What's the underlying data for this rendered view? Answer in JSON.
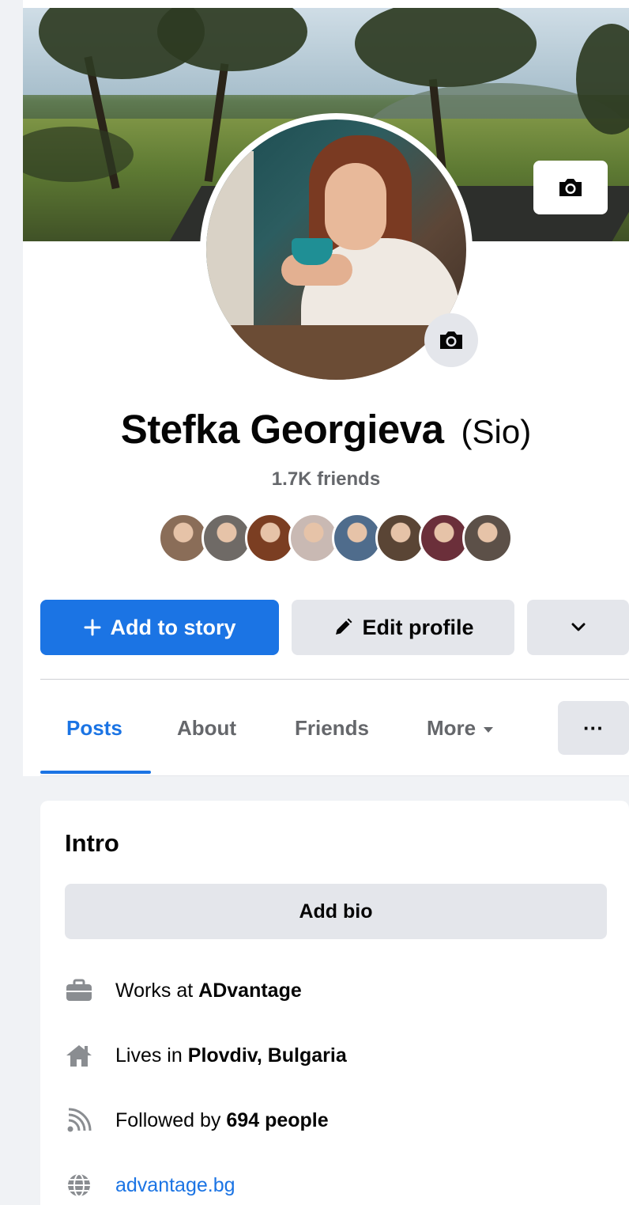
{
  "profile": {
    "name": "Stefka Georgieva",
    "alternate_name": "(Sio)",
    "friends_count": "1.7K friends"
  },
  "friend_avatar_colors": [
    "#8a6d58",
    "#6f6a66",
    "#7b3e22",
    "#c9b9b3",
    "#4f6c8c",
    "#5a4535",
    "#6b2f3a",
    "#5c5048"
  ],
  "actions": {
    "add_story_label": "Add to story",
    "edit_profile_label": "Edit profile"
  },
  "tabs": [
    {
      "label": "Posts",
      "active": true
    },
    {
      "label": "About",
      "active": false
    },
    {
      "label": "Friends",
      "active": false
    },
    {
      "label": "More",
      "active": false
    }
  ],
  "tab_overflow_label": "···",
  "intro": {
    "title": "Intro",
    "add_bio_label": "Add bio",
    "work_prefix": "Works at",
    "work_place": "ADvantage",
    "home_prefix": "Lives in",
    "home_place": "Plovdiv, Bulgaria",
    "followers_prefix": "Followed by",
    "followers_count": "694 people",
    "website": "advantage.bg"
  },
  "colors": {
    "accent": "#1b74e4",
    "secondary_button": "#e4e6eb",
    "muted_text": "#65676b",
    "icon_gray": "#8a8d91"
  },
  "icons": {
    "cover_camera": "camera-icon",
    "avatar_camera": "camera-icon",
    "add_story": "plus-icon",
    "edit_profile": "pencil-icon",
    "dropdown": "chevron-down-icon",
    "work": "briefcase-icon",
    "home": "house-icon",
    "followers": "rss-icon",
    "website": "globe-icon"
  }
}
